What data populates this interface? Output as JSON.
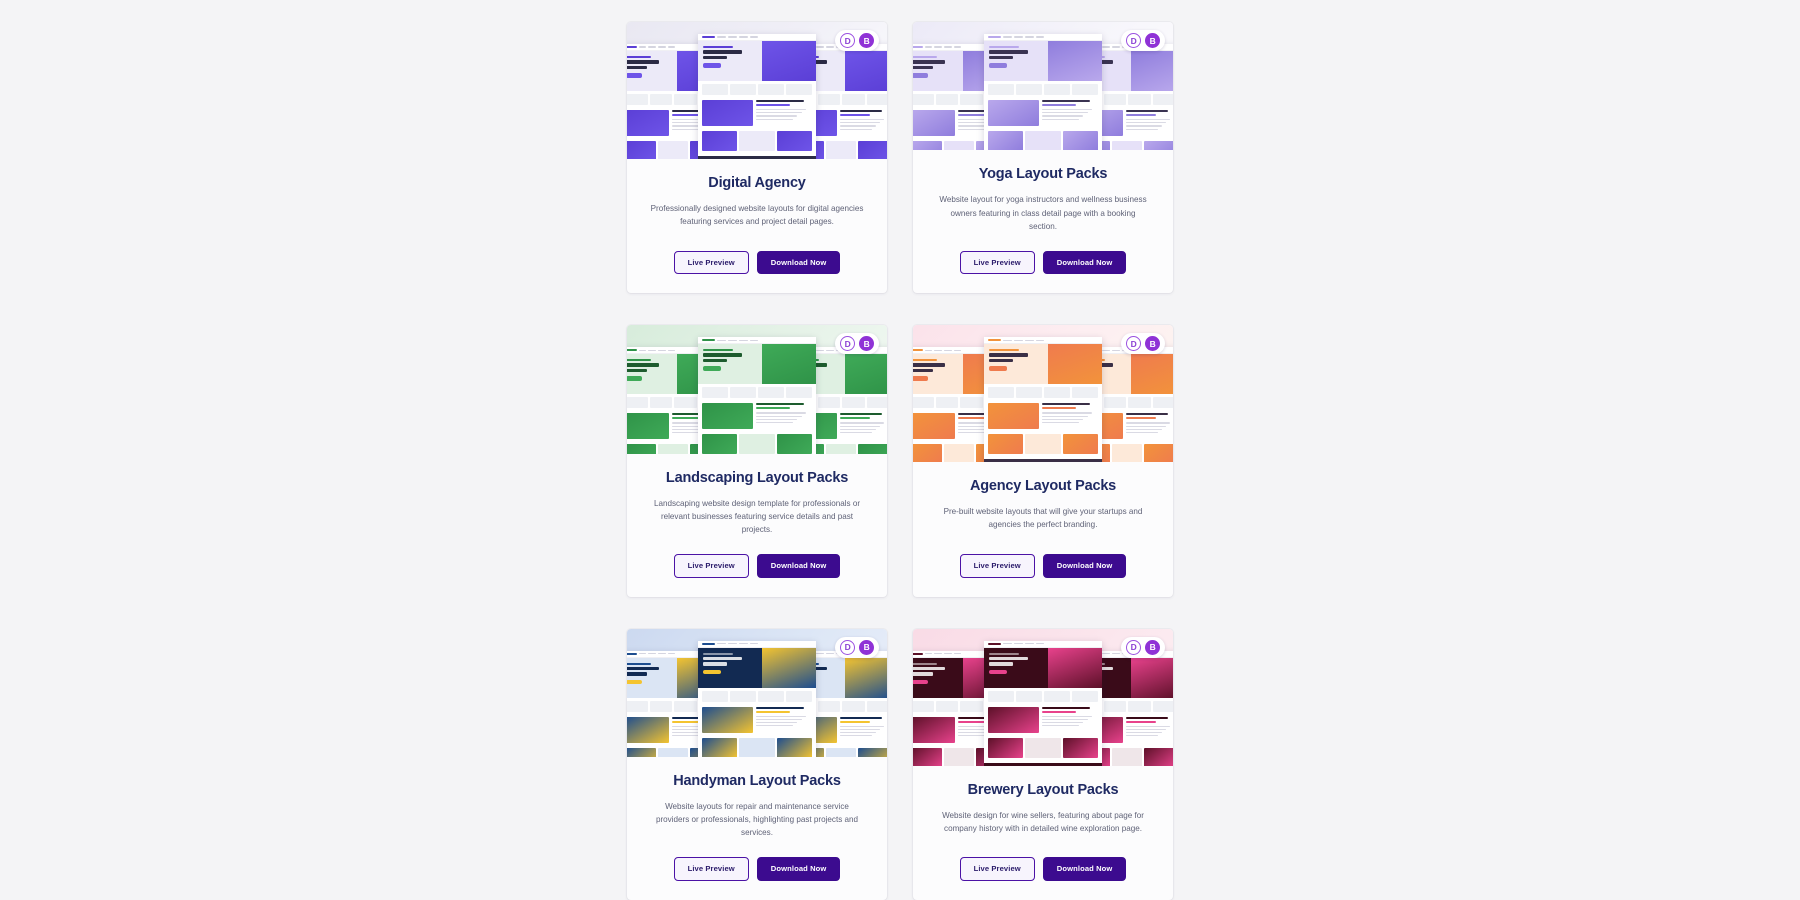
{
  "page": {
    "background_color": "#f4f4f6",
    "card_background": "#fcfcfd",
    "title_color": "#1f2a63",
    "accent_color": "#3c0b8f"
  },
  "badges": {
    "divi": {
      "label": "D",
      "name": "divi-badge",
      "color": "#8b3fd4"
    },
    "builder": {
      "label": "B",
      "name": "builder-badge",
      "color": "#8f32d6"
    }
  },
  "buttons": {
    "live_preview": "Live Preview",
    "download_now": "Download Now"
  },
  "cards": [
    {
      "id": "digital-agency",
      "title": "Digital Agency",
      "description": "Professionally designed website layouts for digital agencies featuring services and project detail pages.",
      "thumb_background": "linear-gradient(135deg, #e9e8f2 0%, #f0eff7 45%, #ffffff 100%)",
      "palette": {
        "primary": "#5b3fd6",
        "secondary": "#eceaf8",
        "dark": "#2b2b45",
        "accent": "#6e54e8"
      }
    },
    {
      "id": "yoga-layout-packs",
      "title": "Yoga Layout Packs",
      "description": "Website layout for yoga instructors and wellness business owners featuring in class detail page with a booking section.",
      "thumb_background": "linear-gradient(135deg, #eceaf7 0%, #f6f5fb 50%, #ffffff 100%)",
      "palette": {
        "primary": "#b9a8ec",
        "secondary": "#e6e1f8",
        "dark": "#3a3352",
        "accent": "#8f7ddd"
      }
    },
    {
      "id": "landscaping-layout-packs",
      "title": "Landscaping Layout Packs",
      "description": "Landscaping website design template for professionals or relevant businesses featuring service details and past projects.",
      "thumb_background": "linear-gradient(135deg, #d7ecdb 0%, #e7f3e9 50%, #f6fbf7 100%)",
      "palette": {
        "primary": "#2f9348",
        "secondary": "#dff0e2",
        "dark": "#1d5c2e",
        "accent": "#3faa58"
      }
    },
    {
      "id": "agency-layout-packs",
      "title": "Agency Layout Packs",
      "description": "Pre-built website layouts that will give your startups and agencies the perfect branding.",
      "thumb_background": "linear-gradient(135deg, #fbe2ea 0%, #fdeef1 45%, #fdf7f0 100%)",
      "palette": {
        "primary": "#f2933b",
        "secondary": "#fde9d9",
        "dark": "#3a2f46",
        "accent": "#ef7b4e"
      }
    },
    {
      "id": "handyman-layout-packs",
      "title": "Handyman Layout Packs",
      "description": "Website layouts for repair and maintenance service providers or professionals, highlighting past projects and services.",
      "thumb_background": "linear-gradient(135deg, #ccd9f0 0%, #dde7f6 50%, #eef1fb 100%)",
      "palette": {
        "primary": "#1d4d8f",
        "secondary": "#dbe5f4",
        "dark": "#122a52",
        "accent": "#f4c430"
      }
    },
    {
      "id": "brewery-layout-packs",
      "title": "Brewery Layout Packs",
      "description": "Website design for wine sellers, featuring about page for company history with in detailed wine exploration page.",
      "thumb_background": "linear-gradient(135deg, #f9dbe6 0%, #fbe6ed 50%, #fdf3f6 100%)",
      "palette": {
        "primary": "#5c1028",
        "secondary": "#efe6e9",
        "dark": "#3a0b19",
        "accent": "#e8428c"
      }
    }
  ]
}
